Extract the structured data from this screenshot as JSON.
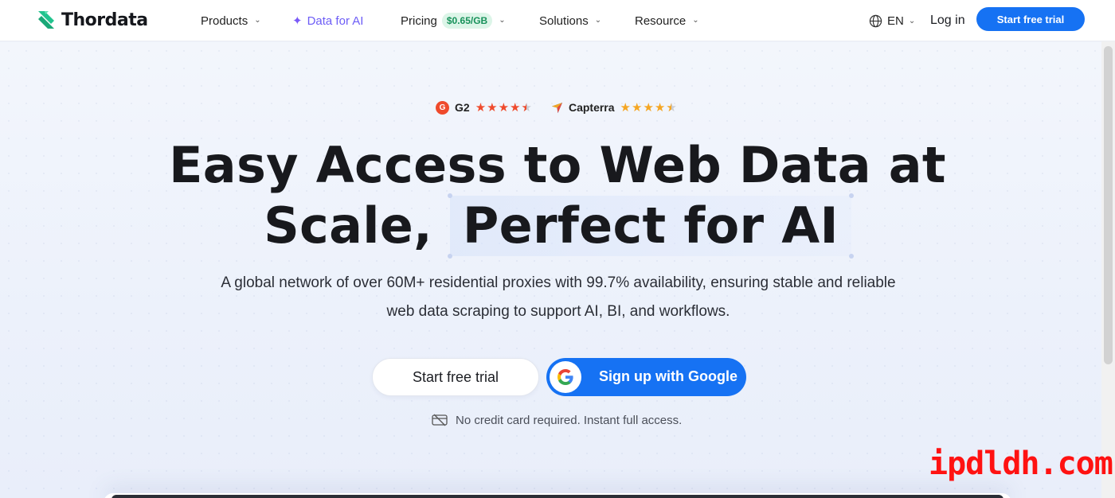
{
  "brand": {
    "name": "Thordata",
    "accent": "#1672f3",
    "logo_color": "#22c38e"
  },
  "nav": {
    "products": "Products",
    "data_for_ai": "Data for AI",
    "pricing": "Pricing",
    "pricing_badge": "$0.65/GB",
    "solutions": "Solutions",
    "resource": "Resource",
    "language": "EN",
    "login": "Log in",
    "start_trial": "Start free trial"
  },
  "ratings": [
    {
      "name": "G2",
      "badge": "G",
      "stars": 4.5,
      "star_color": "#ef4a2c"
    },
    {
      "name": "Capterra",
      "stars": 4.5,
      "star_color": "#f5a623"
    }
  ],
  "hero": {
    "title_line1": "Easy Access to Web Data at",
    "title_line2_plain": "Scale,",
    "title_line2_highlight": "Perfect for AI",
    "subtitle": "A global network of over 60M+ residential proxies with 99.7% availability, ensuring stable and reliable web data scraping to support AI, BI, and workflows.",
    "cta_trial": "Start free trial",
    "cta_google": "Sign up with Google",
    "note": "No credit card required. Instant full access."
  },
  "icons": {
    "logo": "thordata-logo-icon",
    "sparkle": "sparkle-icon",
    "chevron": "chevron-down-icon",
    "globe": "globe-icon",
    "google": "google-icon",
    "no_card": "no-credit-card-icon"
  },
  "watermark": "ipdldh.com"
}
